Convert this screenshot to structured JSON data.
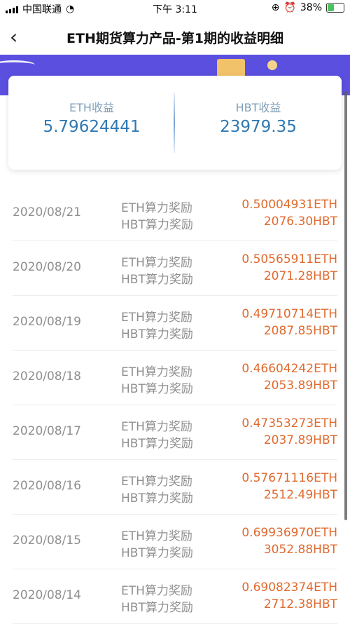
{
  "status_bar": {
    "carrier": "中国联通",
    "time": "下午 3:11",
    "battery": "38%"
  },
  "nav": {
    "back": "‹",
    "title": "ETH期货算力产品-第1期的收益明细"
  },
  "summary": {
    "eth_label": "ETH收益",
    "eth_value": "5.79624441",
    "hbt_label": "HBT收益",
    "hbt_value": "23979.35"
  },
  "rows": [
    {
      "date": "2020/08/21",
      "label1": "ETH算力奖励",
      "value1": "0.50004931ETH",
      "label2": "HBT算力奖励",
      "value2": "2076.30HBT"
    },
    {
      "date": "2020/08/20",
      "label1": "ETH算力奖励",
      "value1": "0.50565911ETH",
      "label2": "HBT算力奖励",
      "value2": "2071.28HBT"
    },
    {
      "date": "2020/08/19",
      "label1": "ETH算力奖励",
      "value1": "0.49710714ETH",
      "label2": "HBT算力奖励",
      "value2": "2087.85HBT"
    },
    {
      "date": "2020/08/18",
      "label1": "ETH算力奖励",
      "value1": "0.46604242ETH",
      "label2": "HBT算力奖励",
      "value2": "2053.89HBT"
    },
    {
      "date": "2020/08/17",
      "label1": "ETH算力奖励",
      "value1": "0.47353273ETH",
      "label2": "HBT算力奖励",
      "value2": "2037.89HBT"
    },
    {
      "date": "2020/08/16",
      "label1": "ETH算力奖励",
      "value1": "0.57671116ETH",
      "label2": "HBT算力奖励",
      "value2": "2512.49HBT"
    },
    {
      "date": "2020/08/15",
      "label1": "ETH算力奖励",
      "value1": "0.69936970ETH",
      "label2": "HBT算力奖励",
      "value2": "3052.88HBT"
    },
    {
      "date": "2020/08/14",
      "label1": "ETH算力奖励",
      "value1": "0.69082374ETH",
      "label2": "HBT算力奖励",
      "value2": "2712.38HBT"
    }
  ]
}
